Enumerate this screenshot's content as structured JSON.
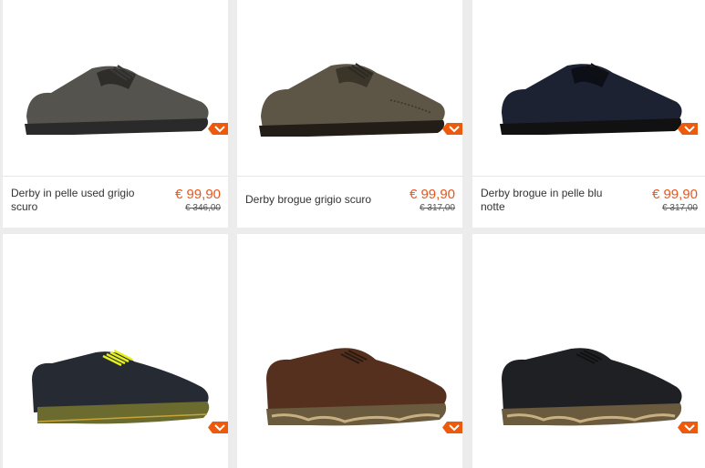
{
  "products": [
    {
      "name": "Derby in pelle used grigio scuro",
      "price": "€ 99,90",
      "old_price": "€ 346,00",
      "upper": "#55534e",
      "dark": "#2f2d2a",
      "sole": "#2a2a2a",
      "lace": "#3a3a3a"
    },
    {
      "name": "Derby brogue grigio scuro",
      "price": "€ 99,90",
      "old_price": "€ 317,00",
      "upper": "#5d5546",
      "dark": "#3a3429",
      "sole": "#231d17",
      "lace": "#2d2a25"
    },
    {
      "name": "Derby brogue in pelle blu notte",
      "price": "€ 99,90",
      "old_price": "€ 317,00",
      "upper": "#1d2233",
      "dark": "#0d0f18",
      "sole": "#111",
      "lace": "#111"
    },
    {
      "name": "",
      "price": "",
      "old_price": "",
      "upper": "#262a33",
      "dark": "#15171d",
      "sole": "#6b6a2f",
      "lace": "#e4f01a"
    },
    {
      "name": "",
      "price": "",
      "old_price": "",
      "upper": "#56301e",
      "dark": "#2f1a10",
      "sole": "#6a5a3e",
      "lace": "#2a1a10"
    },
    {
      "name": "",
      "price": "",
      "old_price": "",
      "upper": "#1f2024",
      "dark": "#0e0e10",
      "sole": "#6a5a3e",
      "lace": "#111"
    }
  ]
}
